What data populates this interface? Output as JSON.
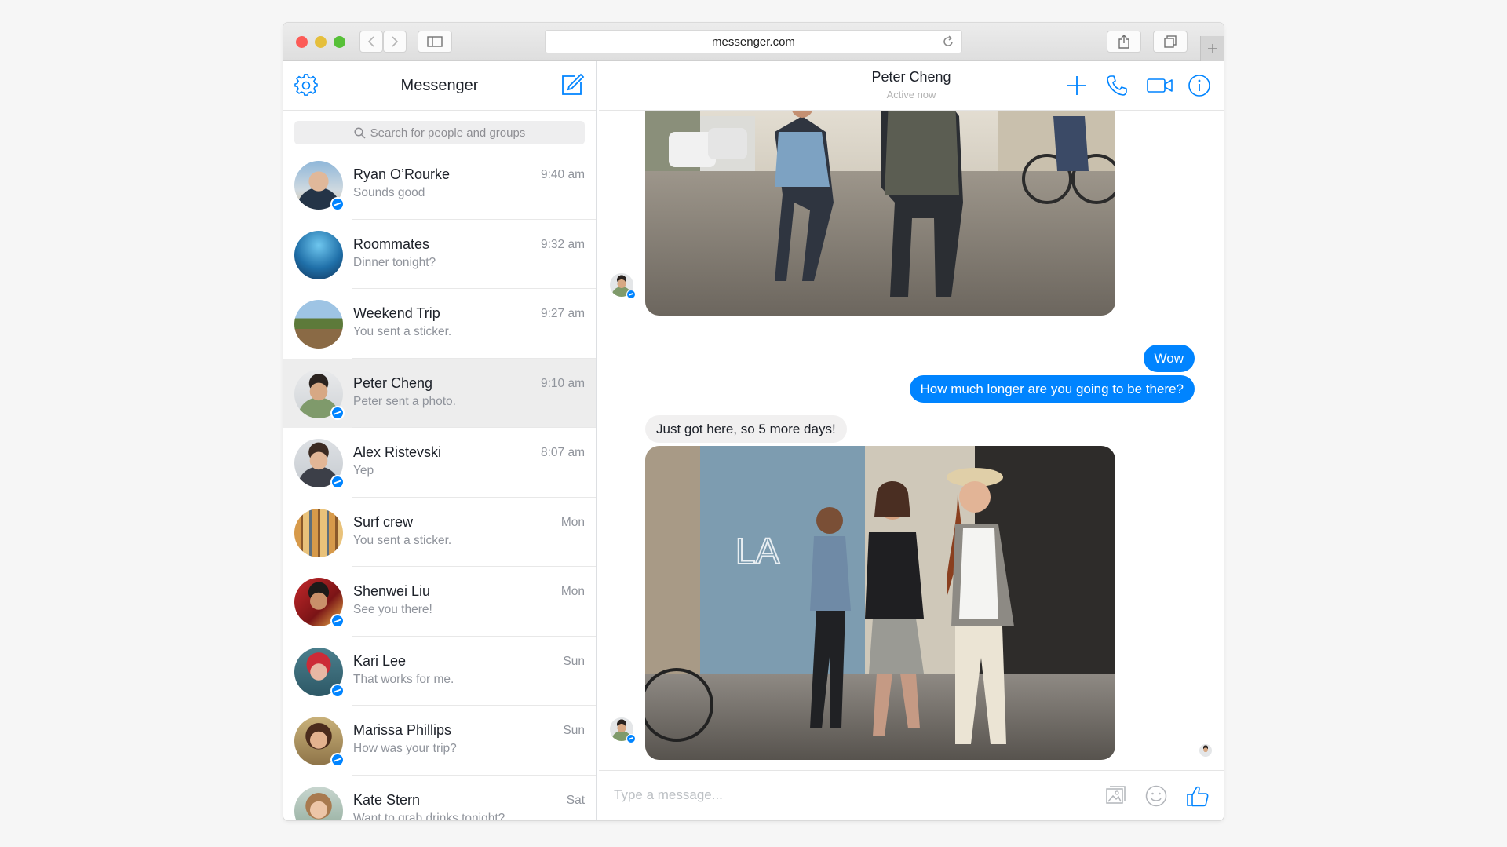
{
  "browser": {
    "url": "messenger.com"
  },
  "sidebar": {
    "title": "Messenger",
    "search_placeholder": "Search for people and groups",
    "conversations": [
      {
        "name": "Ryan O’Rourke",
        "snippet": "Sounds good",
        "time": "9:40 am",
        "messenger_badge": true,
        "active": false
      },
      {
        "name": "Roommates",
        "snippet": "Dinner tonight?",
        "time": "9:32 am",
        "messenger_badge": false,
        "active": false
      },
      {
        "name": "Weekend Trip",
        "snippet": "You sent a sticker.",
        "time": "9:27 am",
        "messenger_badge": false,
        "active": false
      },
      {
        "name": "Peter Cheng",
        "snippet": "Peter sent a photo.",
        "time": "9:10 am",
        "messenger_badge": true,
        "active": true
      },
      {
        "name": "Alex Ristevski",
        "snippet": "Yep",
        "time": "8:07 am",
        "messenger_badge": true,
        "active": false
      },
      {
        "name": "Surf crew",
        "snippet": "You sent a sticker.",
        "time": "Mon",
        "messenger_badge": false,
        "active": false
      },
      {
        "name": "Shenwei Liu",
        "snippet": "See you there!",
        "time": "Mon",
        "messenger_badge": true,
        "active": false
      },
      {
        "name": "Kari Lee",
        "snippet": "That works for me.",
        "time": "Sun",
        "messenger_badge": true,
        "active": false
      },
      {
        "name": "Marissa Phillips",
        "snippet": "How was your trip?",
        "time": "Sun",
        "messenger_badge": true,
        "active": false
      },
      {
        "name": "Kate Stern",
        "snippet": "Want to grab drinks tonight?",
        "time": "Sat",
        "messenger_badge": true,
        "active": false
      }
    ]
  },
  "thread": {
    "name": "Peter Cheng",
    "status": "Active now",
    "messages": {
      "out_1": "Wow",
      "out_2": "How much longer are you going to be there?",
      "in_1": "Just got here, so 5 more days!"
    },
    "composer_placeholder": "Type a message..."
  },
  "colors": {
    "accent": "#0084ff",
    "active_row": "#ededed",
    "secondary_text": "#90949c"
  },
  "icons": [
    "settings-gear-icon",
    "compose-icon",
    "search-icon",
    "add-people-icon",
    "phone-icon",
    "video-camera-icon",
    "info-icon",
    "photo-icon",
    "emoji-icon",
    "thumbs-up-icon"
  ]
}
